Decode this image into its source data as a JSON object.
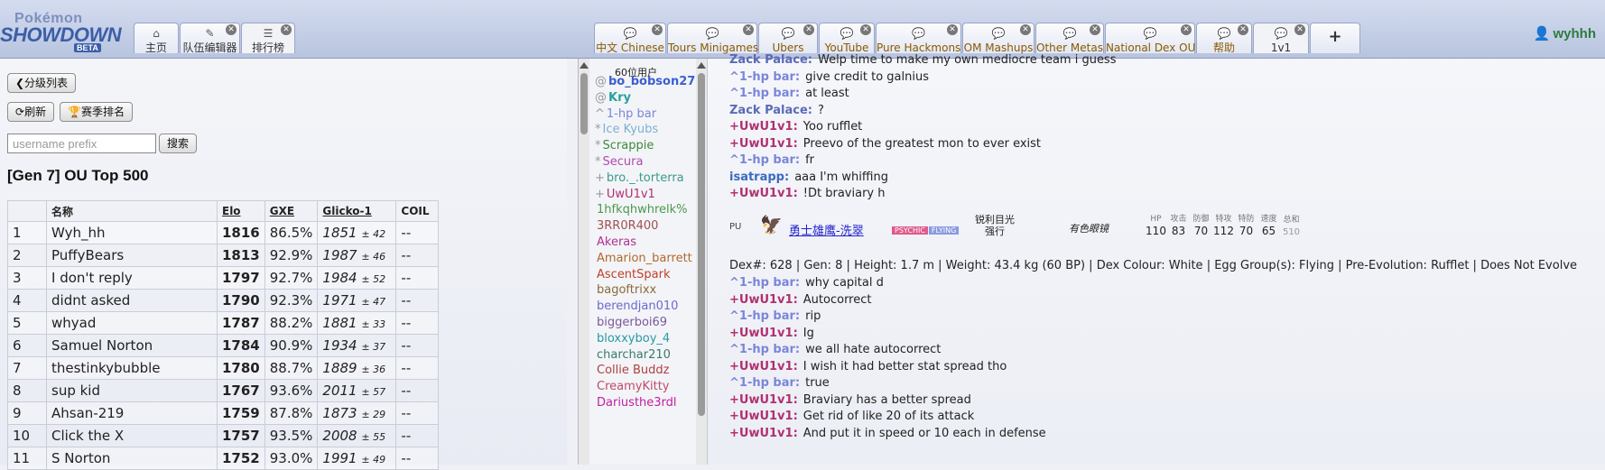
{
  "app": {
    "logo": {
      "line1": "Pokémon",
      "line2": "SHOWDOWN",
      "line3": "BETA"
    },
    "tabs": [
      {
        "label": "主页",
        "icon": "home-icon"
      },
      {
        "label": "队伍编辑器",
        "icon": "edit-icon"
      },
      {
        "label": "排行榜",
        "icon": "list-icon"
      }
    ],
    "room_tabs": [
      {
        "label": "中文 Chinese"
      },
      {
        "label": "Tours Minigames"
      },
      {
        "label": "Ubers"
      },
      {
        "label": "YouTube"
      },
      {
        "label": "Pure Hackmons"
      },
      {
        "label": "OM Mashups"
      },
      {
        "label": "Other Metas"
      },
      {
        "label": "National Dex OU"
      },
      {
        "label": "帮助"
      },
      {
        "label": "1v1"
      }
    ],
    "add_tab": "+",
    "username": "wyhhh"
  },
  "ladder": {
    "back_button": "❮分级列表",
    "refresh_button": "刷新",
    "season_button": "赛季排名",
    "prefix_placeholder": "username prefix",
    "search_button": "搜索",
    "heading": "[Gen 7] OU Top 500",
    "columns": [
      "",
      "名称",
      "Elo",
      "GXE",
      "Glicko-1",
      "COIL"
    ],
    "rows": [
      {
        "rank": "1",
        "name": "Wyh_hh",
        "elo": "1816",
        "gxe": "86.5%",
        "g": "1851",
        "d": "± 42",
        "coil": "--"
      },
      {
        "rank": "2",
        "name": "PuffyBears",
        "elo": "1813",
        "gxe": "92.9%",
        "g": "1987",
        "d": "± 46",
        "coil": "--"
      },
      {
        "rank": "3",
        "name": "I don't reply",
        "elo": "1797",
        "gxe": "92.7%",
        "g": "1984",
        "d": "± 52",
        "coil": "--"
      },
      {
        "rank": "4",
        "name": "didnt asked",
        "elo": "1790",
        "gxe": "92.3%",
        "g": "1971",
        "d": "± 47",
        "coil": "--"
      },
      {
        "rank": "5",
        "name": "whyad",
        "elo": "1787",
        "gxe": "88.2%",
        "g": "1881",
        "d": "± 33",
        "coil": "--"
      },
      {
        "rank": "6",
        "name": "Samuel Norton",
        "elo": "1784",
        "gxe": "90.9%",
        "g": "1934",
        "d": "± 37",
        "coil": "--"
      },
      {
        "rank": "7",
        "name": "thestinkybubble",
        "elo": "1780",
        "gxe": "88.7%",
        "g": "1889",
        "d": "± 36",
        "coil": "--"
      },
      {
        "rank": "8",
        "name": "sup kid",
        "elo": "1767",
        "gxe": "93.6%",
        "g": "2011",
        "d": "± 57",
        "coil": "--"
      },
      {
        "rank": "9",
        "name": "Ahsan-219",
        "elo": "1759",
        "gxe": "87.8%",
        "g": "1873",
        "d": "± 29",
        "coil": "--"
      },
      {
        "rank": "10",
        "name": "Click the X",
        "elo": "1757",
        "gxe": "93.5%",
        "g": "2008",
        "d": "± 55",
        "coil": "--"
      },
      {
        "rank": "11",
        "name": "S Norton",
        "elo": "1752",
        "gxe": "93.0%",
        "g": "1991",
        "d": "± 49",
        "coil": "--"
      }
    ]
  },
  "userlist": {
    "count": "60位用户",
    "users": [
      {
        "rank": "@",
        "name": "bo_bobson27",
        "color": "#3a5fd0",
        "bold": true
      },
      {
        "rank": "@",
        "name": "Kry",
        "color": "#2aa0a0",
        "bold": true
      },
      {
        "rank": "^",
        "name": "1-hp bar",
        "color": "#7a86d8",
        "bold": false
      },
      {
        "rank": "*",
        "name": "Ice Kyubs",
        "color": "#7ab0d0",
        "bold": false
      },
      {
        "rank": "*",
        "name": "Scrappie",
        "color": "#3c8a3c",
        "bold": false
      },
      {
        "rank": "*",
        "name": "Secura",
        "color": "#b04ab0",
        "bold": false
      },
      {
        "rank": "+",
        "name": "bro._.torterra",
        "color": "#3a9a8a",
        "bold": false
      },
      {
        "rank": "+",
        "name": "UwU1v1",
        "color": "#b03070",
        "bold": false
      },
      {
        "rank": "",
        "name": "1hfkqhwhrelk%",
        "color": "#4a9a4a",
        "bold": false
      },
      {
        "rank": "",
        "name": "3RR0R400",
        "color": "#a05050",
        "bold": false
      },
      {
        "rank": "",
        "name": "Akeras",
        "color": "#b03090",
        "bold": false
      },
      {
        "rank": "",
        "name": "Amarion_barrett",
        "color": "#b06a2a",
        "bold": false
      },
      {
        "rank": "",
        "name": "AscentSpark",
        "color": "#c0402a",
        "bold": false
      },
      {
        "rank": "",
        "name": "bagoftrixx",
        "color": "#8a6a3a",
        "bold": false
      },
      {
        "rank": "",
        "name": "berendjan010",
        "color": "#6a6ad0",
        "bold": false
      },
      {
        "rank": "",
        "name": "biggerboi69",
        "color": "#7a5a9a",
        "bold": false
      },
      {
        "rank": "",
        "name": "bloxxyboy_4",
        "color": "#2a9aa0",
        "bold": false
      },
      {
        "rank": "",
        "name": "charchar210",
        "color": "#3a7a6a",
        "bold": false
      },
      {
        "rank": "",
        "name": "Collie Buddz",
        "color": "#b04040",
        "bold": false
      },
      {
        "rank": "",
        "name": "CreamyKitty",
        "color": "#c04a6a",
        "bold": false
      },
      {
        "rank": "",
        "name": "Dariusthe3rdl",
        "color": "#c020a0",
        "bold": false
      }
    ]
  },
  "chat": {
    "messages": [
      {
        "name": "Zack Palace:",
        "text": "Welp time to make my own mediocre team i guess",
        "color": "#5a6ab8"
      },
      {
        "name": "^1-hp bar:",
        "text": "give credit to galnius",
        "color": "#7a86d8"
      },
      {
        "name": "^1-hp bar:",
        "text": "at least",
        "color": "#7a86d8"
      },
      {
        "name": "Zack Palace:",
        "text": "?",
        "color": "#5a6ab8"
      },
      {
        "name": "+UwU1v1:",
        "text": "Yoo rufflet",
        "color": "#b03070"
      },
      {
        "name": "+UwU1v1:",
        "text": "Preevo of the greatest mon to ever exist",
        "color": "#b03070"
      },
      {
        "name": "^1-hp bar:",
        "text": "fr",
        "color": "#7a86d8"
      },
      {
        "name": "isatrapp:",
        "text": "aaa I'm whiffing",
        "color": "#3a6ac0"
      },
      {
        "name": "+UwU1v1:",
        "text": "!Dt braviary h",
        "color": "#b03070"
      }
    ],
    "dex": {
      "tier": "PU",
      "name": "勇士雄鹰-洗翠",
      "types": [
        "PSYCHIC",
        "FLYING"
      ],
      "ability1": "锐利目光",
      "ability2": "强行",
      "hidden": "有色眼镜",
      "stat_labels": [
        "HP",
        "攻击",
        "防御",
        "特攻",
        "特防",
        "速度",
        "总和"
      ],
      "stat_values": [
        "110",
        "83",
        "70",
        "112",
        "70",
        "65",
        "510"
      ],
      "info": "Dex#: 628 | Gen: 8 | Height: 1.7 m | Weight: 43.4 kg (60 BP) | Dex Colour: White | Egg Group(s): Flying | Pre-Evolution: Rufflet | Does Not Evolve"
    },
    "messages2": [
      {
        "name": "^1-hp bar:",
        "text": "why capital d",
        "color": "#7a86d8"
      },
      {
        "name": "+UwU1v1:",
        "text": "Autocorrect",
        "color": "#b03070"
      },
      {
        "name": "^1-hp bar:",
        "text": "rip",
        "color": "#7a86d8"
      },
      {
        "name": "+UwU1v1:",
        "text": "Ig",
        "color": "#b03070"
      },
      {
        "name": "^1-hp bar:",
        "text": "we all hate autocorrect",
        "color": "#7a86d8"
      },
      {
        "name": "+UwU1v1:",
        "text": "I wish it had better stat spread tho",
        "color": "#b03070"
      },
      {
        "name": "^1-hp bar:",
        "text": "true",
        "color": "#7a86d8"
      },
      {
        "name": "+UwU1v1:",
        "text": "Braviary has a better spread",
        "color": "#b03070"
      },
      {
        "name": "+UwU1v1:",
        "text": "Get rid of like 20 of its attack",
        "color": "#b03070"
      },
      {
        "name": "+UwU1v1:",
        "text": "And put it in speed or 10 each in defense",
        "color": "#b03070"
      }
    ]
  }
}
